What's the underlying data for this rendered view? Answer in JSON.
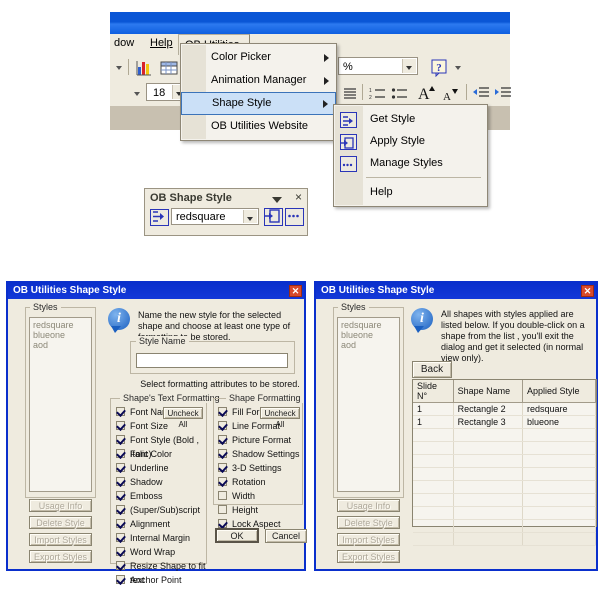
{
  "app": {
    "menubar": {
      "window_label": "dow",
      "help_label": "Help",
      "ob_utilities_label": "OB Utilities"
    },
    "toolbar": {
      "font_size_value": "18",
      "zoom_value": "%",
      "chart_icon": "chart-icon",
      "table_icon": "table-icon",
      "help_icon": "question-mark-icon",
      "numbered_list_icon": "numbered-list-icon",
      "bullet_list_icon": "bullet-list-icon",
      "grow_font_icon": "grow-font-icon",
      "shrink_font_icon": "shrink-font-icon",
      "decrease_indent_icon": "decrease-indent-icon",
      "increase_indent_icon": "increase-indent-icon"
    }
  },
  "menu": {
    "items": [
      {
        "label": "Color Picker",
        "has_submenu": true,
        "selected": false
      },
      {
        "label": "Animation Manager",
        "has_submenu": true,
        "selected": false
      },
      {
        "label": "Shape Style",
        "has_submenu": true,
        "selected": true
      },
      {
        "label": "OB Utilities Website",
        "has_submenu": false,
        "selected": false
      }
    ]
  },
  "submenu": {
    "items": [
      {
        "label": "Get Style",
        "icon": "get-style-icon"
      },
      {
        "label": "Apply Style",
        "icon": "apply-style-icon"
      },
      {
        "label": "Manage Styles",
        "icon": "manage-styles-icon"
      },
      {
        "label": "Help",
        "icon": ""
      }
    ]
  },
  "shape_style_toolbar": {
    "title": "OB Shape Style",
    "style_value": "redsquare",
    "collapse_icon": "chevron-down-icon",
    "close_icon": "×",
    "get_style_icon": "get-style-icon",
    "apply_style_icon": "apply-style-icon",
    "manage_styles_icon": "manage-styles-icon"
  },
  "dialog_left": {
    "title": "OB Utilities Shape Style",
    "close_label": "✕",
    "styles_group_label": "Styles",
    "styles_list": [
      "redsquare",
      "blueone",
      "aod"
    ],
    "info_text": "Name the new style for the selected shape and choose at least one type of formatting to be stored.",
    "style_name_group_label": "Style Name",
    "style_name_value": "",
    "hint_text": "Select formatting attributes to be stored.",
    "text_formatting_group_label": "Shape's Text Formatting",
    "text_formatting_uncheck_label": "Uncheck All",
    "text_formatting_items": [
      {
        "label": "Font Name",
        "checked": true
      },
      {
        "label": "Font Size",
        "checked": true
      },
      {
        "label": "Font Style (Bold , Italic)",
        "checked": true
      },
      {
        "label": "Font Color",
        "checked": true
      },
      {
        "label": "Underline",
        "checked": true
      },
      {
        "label": "Shadow",
        "checked": true
      },
      {
        "label": "Emboss",
        "checked": true
      },
      {
        "label": "(Super/Sub)script",
        "checked": true
      },
      {
        "label": "Alignment",
        "checked": true
      },
      {
        "label": "Internal Margin",
        "checked": true
      },
      {
        "label": "Word Wrap",
        "checked": true
      },
      {
        "label": "Resize Shape to fit text",
        "checked": true
      },
      {
        "label": "Anchor Point",
        "checked": true
      }
    ],
    "shape_formatting_group_label": "Shape Formatting",
    "shape_formatting_uncheck_label": "Uncheck All",
    "shape_formatting_items": [
      {
        "label": "Fill Format",
        "checked": true
      },
      {
        "label": "Line Format",
        "checked": true
      },
      {
        "label": "Picture Format",
        "checked": true
      },
      {
        "label": "Shadow Settings",
        "checked": true
      },
      {
        "label": "3-D Settings",
        "checked": true
      },
      {
        "label": "Rotation",
        "checked": true
      },
      {
        "label": "Width",
        "checked": false
      },
      {
        "label": "Height",
        "checked": false
      },
      {
        "label": "Lock Aspect Ratio",
        "checked": true
      }
    ],
    "side_buttons": [
      {
        "label": "Usage Info",
        "enabled": false
      },
      {
        "label": "Delete Style",
        "enabled": false
      },
      {
        "label": "Import Styles",
        "enabled": false
      },
      {
        "label": "Export Styles",
        "enabled": false
      }
    ],
    "ok_label": "OK",
    "cancel_label": "Cancel"
  },
  "dialog_right": {
    "title": "OB Utilities Shape Style",
    "close_label": "✕",
    "styles_group_label": "Styles",
    "styles_list": [
      "redsquare",
      "blueone",
      "aod"
    ],
    "info_text": "All shapes with styles applied are listed below. If you double-click on a shape from the list , you'll exit the dialog and get it selected (in normal view only).",
    "back_label": "Back",
    "table": {
      "headers": [
        "Slide N°",
        "Shape Name",
        "Applied Style"
      ],
      "rows": [
        [
          "1",
          "Rectangle 2",
          "redsquare"
        ],
        [
          "1",
          "Rectangle 3",
          "blueone"
        ]
      ],
      "empty_rows": 9
    },
    "side_buttons": [
      {
        "label": "Usage Info",
        "enabled": false
      },
      {
        "label": "Delete Style",
        "enabled": false
      },
      {
        "label": "Import Styles",
        "enabled": false
      },
      {
        "label": "Export Styles",
        "enabled": false
      }
    ]
  }
}
